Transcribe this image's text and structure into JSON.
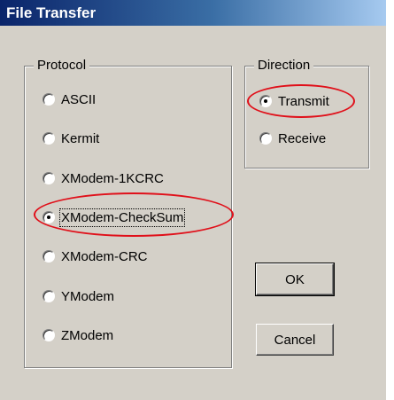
{
  "window": {
    "title": "File Transfer"
  },
  "protocol": {
    "legend": "Protocol",
    "options": [
      "ASCII",
      "Kermit",
      "XModem-1KCRC",
      "XModem-CheckSum",
      "XModem-CRC",
      "YModem",
      "ZModem"
    ],
    "selected": "XModem-CheckSum"
  },
  "direction": {
    "legend": "Direction",
    "options": [
      "Transmit",
      "Receive"
    ],
    "selected": "Transmit"
  },
  "buttons": {
    "ok": "OK",
    "cancel": "Cancel"
  },
  "colors": {
    "titlebar_start": "#0a246a",
    "titlebar_end": "#a6caf0",
    "annotation": "#e0101a",
    "face": "#d4d0c8"
  }
}
